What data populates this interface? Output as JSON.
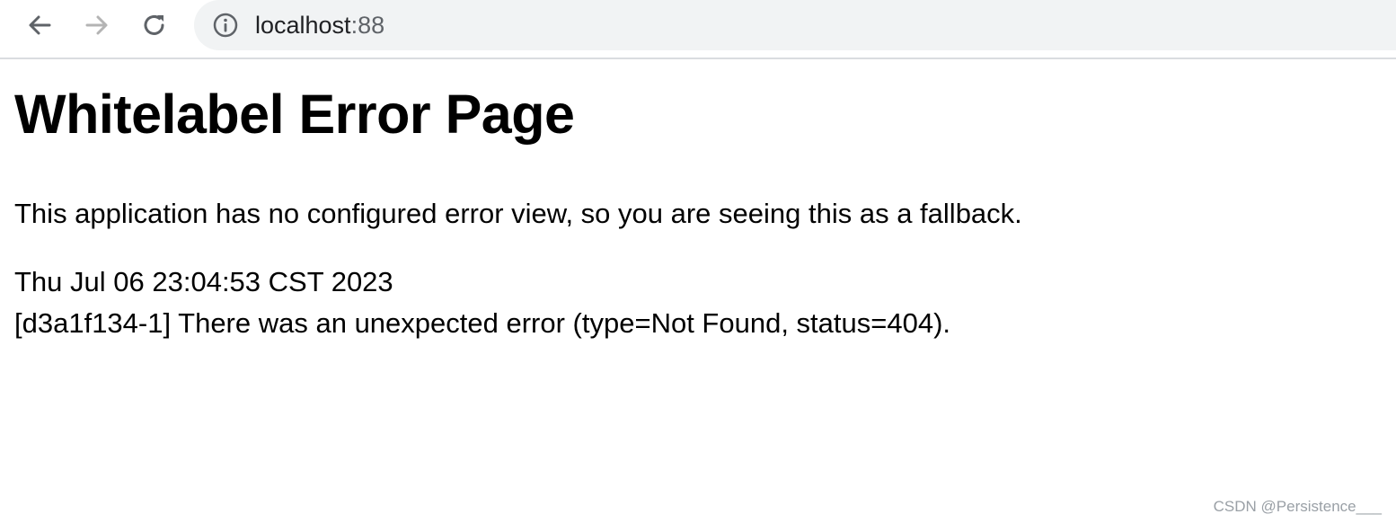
{
  "browser": {
    "back_icon": "arrow-left-icon",
    "forward_icon": "arrow-right-icon",
    "reload_icon": "reload-icon",
    "site_info_icon": "info-icon",
    "url_host": "localhost",
    "url_port": ":88"
  },
  "page": {
    "title": "Whitelabel Error Page",
    "description": "This application has no configured error view, so you are seeing this as a fallback.",
    "timestamp": "Thu Jul 06 23:04:53 CST 2023",
    "error_message": "[d3a1f134-1] There was an unexpected error (type=Not Found, status=404)."
  },
  "watermark": "CSDN @Persistence___",
  "colors": {
    "toolbar_background": "#ffffff",
    "omnibox_background": "#f1f3f4",
    "icon_color": "#5f6368",
    "disabled_icon_color": "#b4b4b4",
    "text_color": "#000000"
  }
}
